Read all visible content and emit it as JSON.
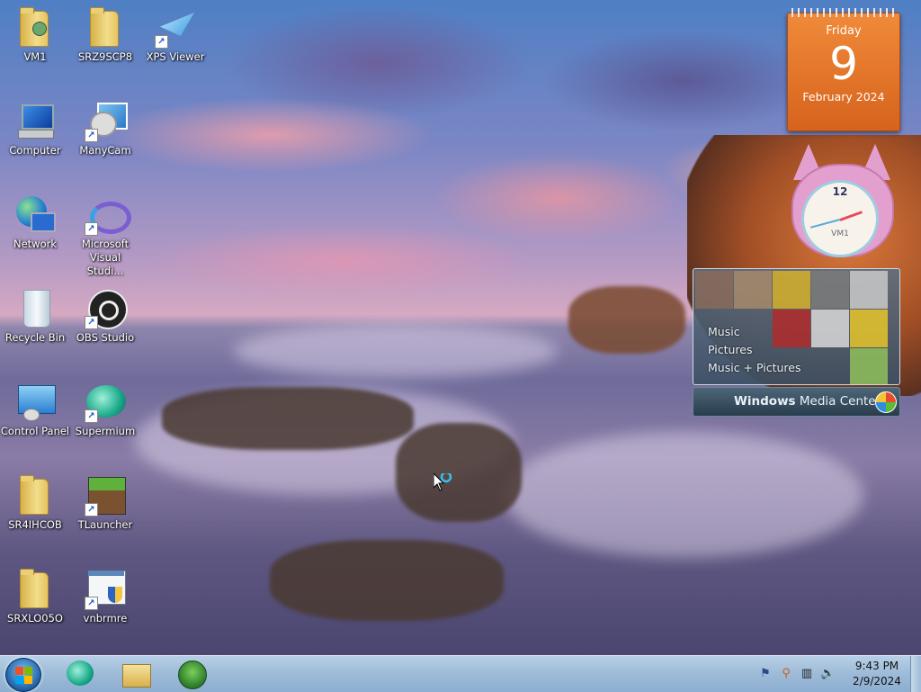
{
  "desktop_icons": [
    {
      "label": "VM1",
      "kind": "user-folder"
    },
    {
      "label": "SRZ9SCP8",
      "kind": "folder"
    },
    {
      "label": "XPS Viewer",
      "kind": "shortcut"
    },
    {
      "label": "Computer",
      "kind": "system"
    },
    {
      "label": "ManyCam",
      "kind": "shortcut"
    },
    {
      "label": "Network",
      "kind": "system"
    },
    {
      "label": "Microsoft Visual Studi...",
      "kind": "shortcut"
    },
    {
      "label": "Recycle Bin",
      "kind": "system"
    },
    {
      "label": "OBS Studio",
      "kind": "shortcut"
    },
    {
      "label": "Control Panel",
      "kind": "system"
    },
    {
      "label": "Supermium",
      "kind": "shortcut"
    },
    {
      "label": "SR4IHCOB",
      "kind": "folder"
    },
    {
      "label": "TLauncher",
      "kind": "shortcut"
    },
    {
      "label": "SRXLO05O",
      "kind": "folder"
    },
    {
      "label": "vnbrmre",
      "kind": "shortcut"
    }
  ],
  "gadgets": {
    "calendar": {
      "day": "Friday",
      "date": "9",
      "month": "February 2024"
    },
    "clock": {
      "number": "12",
      "label": "VM1"
    },
    "media_center": {
      "menu": [
        "Music",
        "Pictures",
        "Music + Pictures"
      ],
      "bar_bold": "Windows",
      "bar_rest": " Media Center"
    }
  },
  "taskbar": {
    "pinned": [
      "supermium-icon",
      "explorer-icon",
      "media-player-icon"
    ],
    "time": "9:43 PM",
    "date": "2/9/2024"
  },
  "colors": {
    "calendar_orange": "#e2742a",
    "taskbar_blue": "#9fbcd9"
  }
}
